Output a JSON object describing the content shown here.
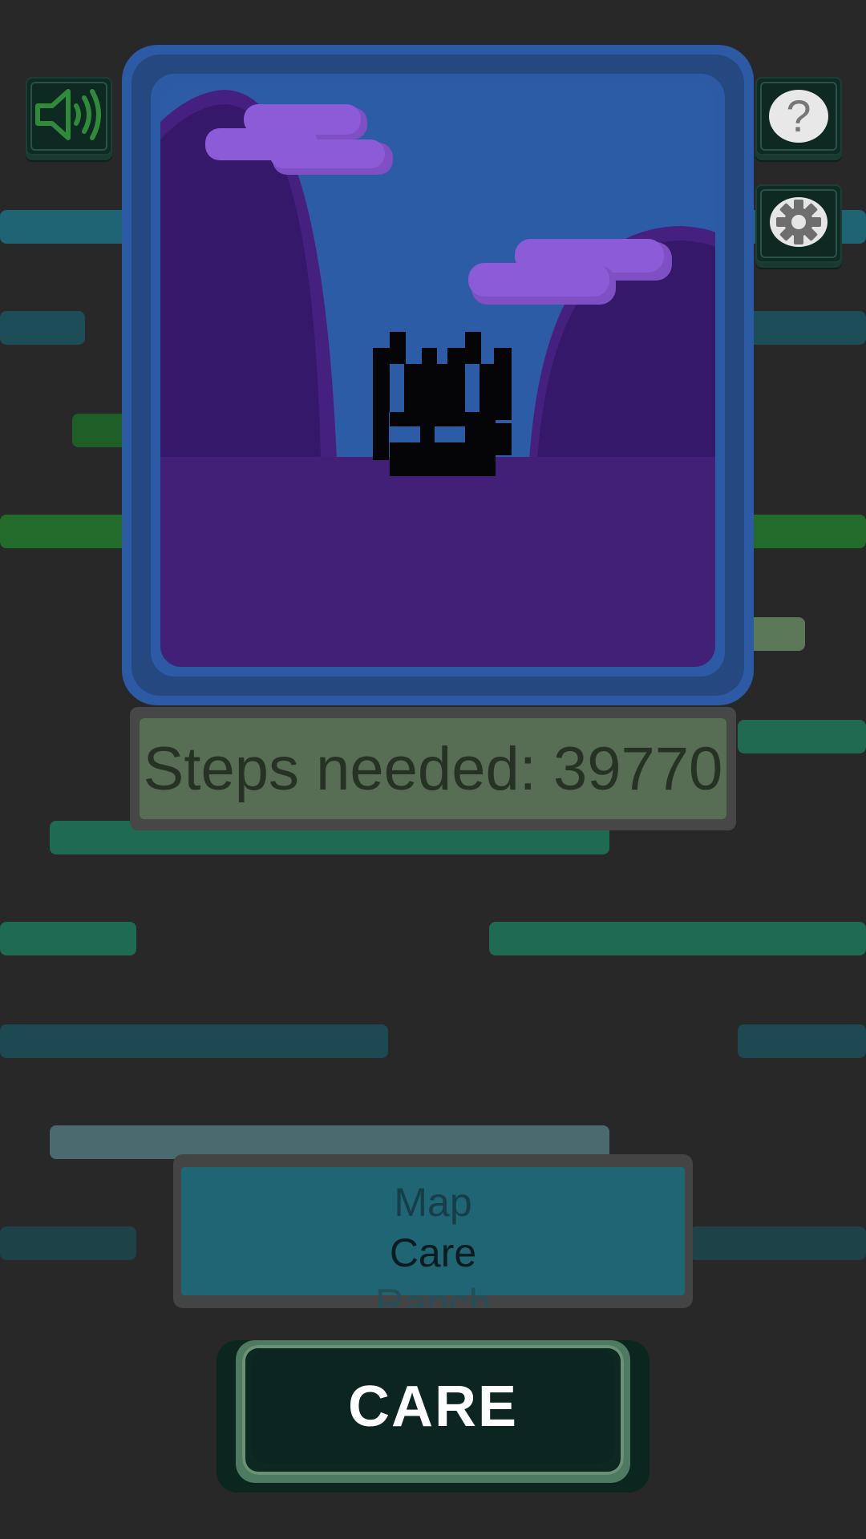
{
  "scene": {
    "steps_needed_text": "Steps needed: 39770"
  },
  "top_left_button": {
    "icon": "speaker-icon"
  },
  "top_right_buttons": [
    {
      "icon": "help-icon",
      "glyph": "?"
    },
    {
      "icon": "gear-icon"
    }
  ],
  "picker": {
    "options": [
      "Map",
      "Care",
      "Ranch"
    ],
    "selected": "Care"
  },
  "action_button": {
    "label": "CARE"
  },
  "colors": {
    "background": "#282828",
    "frame_blue": "#2c5aa5",
    "sky": "#2d5ca6",
    "hill": "#36186a",
    "ground": "#432078",
    "cloud": "#8c5cd8",
    "picker_band": "#1f6573",
    "steps_box": "#576d54"
  }
}
